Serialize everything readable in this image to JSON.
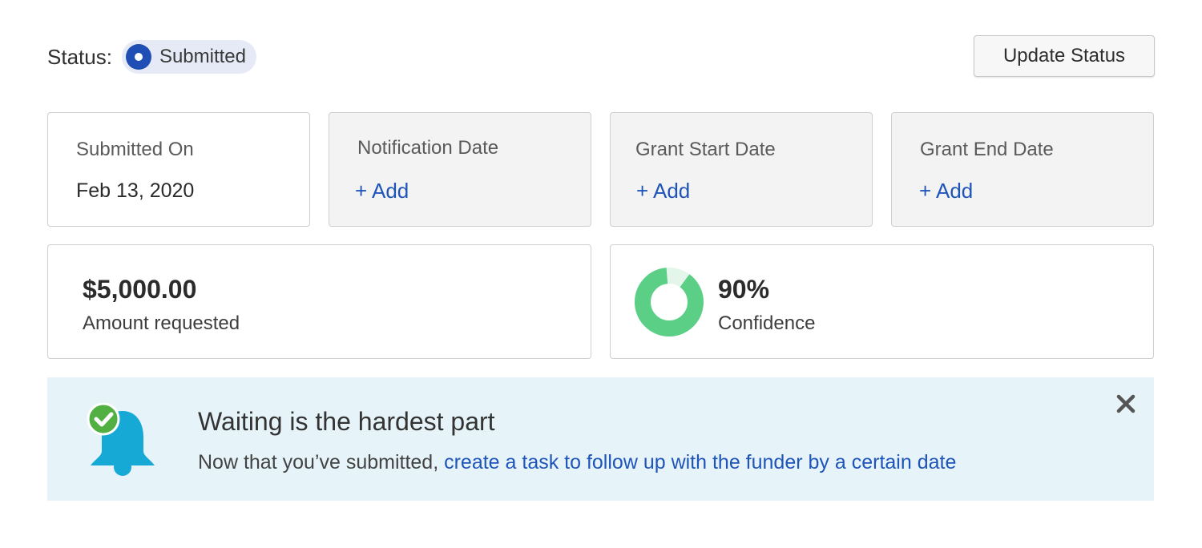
{
  "status": {
    "label": "Status:",
    "value": "Submitted",
    "update_button": "Update Status"
  },
  "dates": [
    {
      "label": "Submitted On",
      "value": "Feb 13, 2020"
    },
    {
      "label": "Notification Date",
      "action": "+ Add"
    },
    {
      "label": "Grant Start Date",
      "action": "+ Add"
    },
    {
      "label": "Grant End Date",
      "action": "+ Add"
    }
  ],
  "amount": {
    "value": "$5,000.00",
    "label": "Amount requested"
  },
  "confidence": {
    "value": "90%",
    "label": "Confidence",
    "fraction": 0.9
  },
  "banner": {
    "title": "Waiting is the hardest part",
    "text": "Now that you’ve submitted, ",
    "link": "create a task to follow up with the funder by a certain date",
    "icon": "bell-check-icon",
    "close_icon": "close-icon"
  },
  "colors": {
    "status_accent": "#1f4fb5",
    "link": "#1f55b8",
    "confidence": "#5ccf87",
    "bell": "#17a9d6",
    "check": "#52b043",
    "banner_bg": "#e6f4f9"
  }
}
